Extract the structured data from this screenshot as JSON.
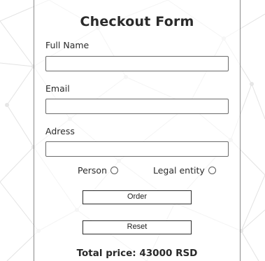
{
  "form": {
    "title": "Checkout Form",
    "full_name_label": "Full Name",
    "full_name_value": "",
    "email_label": "Email",
    "email_value": "",
    "address_label": "Adress",
    "address_value": "",
    "radio_person_label": "Person",
    "radio_legal_label": "Legal entity",
    "order_label": "Order",
    "reset_label": "Reset",
    "total_text": "Total price: 43000 RSD"
  },
  "colors": {
    "background": "#ffffff",
    "network_lines": "#e2e2e2",
    "network_nodes": "#e8e8e8",
    "panel_border": "#8a8a8a",
    "button_border": "#2a2a2a"
  }
}
